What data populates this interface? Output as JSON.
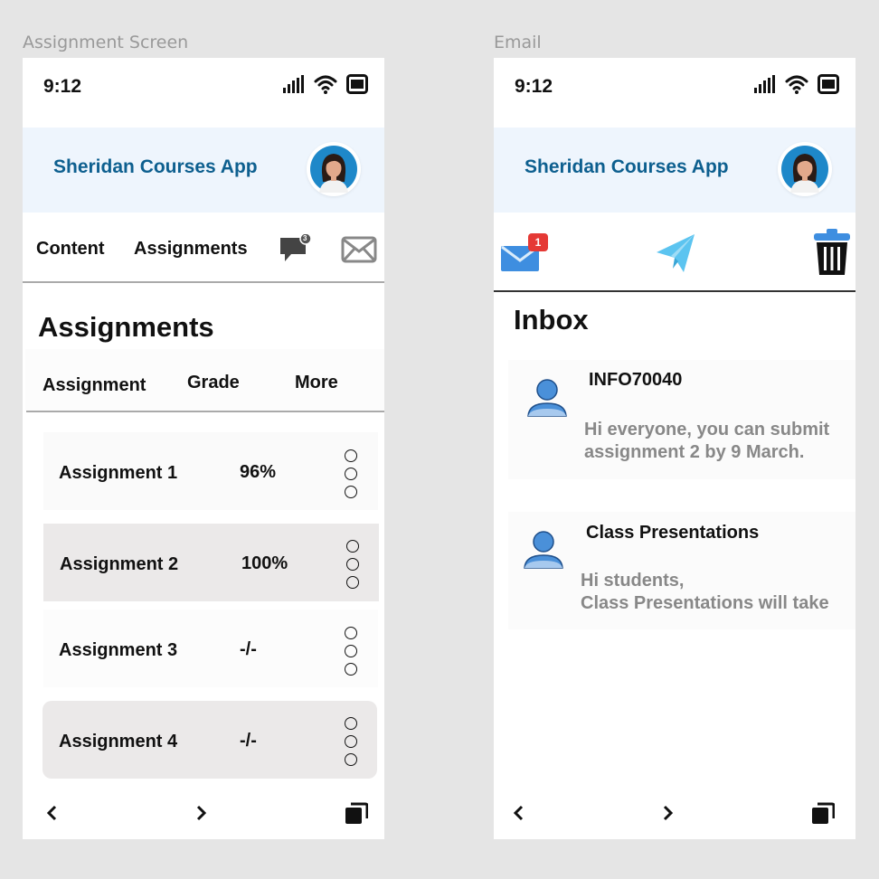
{
  "frames": {
    "assignment_label": "Assignment Screen",
    "email_label": "Email"
  },
  "status": {
    "time": "9:12"
  },
  "app": {
    "title": "Sheridan Courses App"
  },
  "assignment_screen": {
    "tabs": {
      "content": "Content",
      "assignments": "Assignments"
    },
    "chat_badge": "3",
    "section_title": "Assignments",
    "columns": {
      "assignment": "Assignment",
      "grade": "Grade",
      "more": "More"
    },
    "rows": [
      {
        "name": "Assignment 1",
        "grade": "96%"
      },
      {
        "name": "Assignment 2",
        "grade": "100%"
      },
      {
        "name": "Assignment 3",
        "grade": "-/-"
      },
      {
        "name": "Assignment 4",
        "grade": "-/-"
      }
    ]
  },
  "email_screen": {
    "inbox_badge": "1",
    "title": "Inbox",
    "messages": [
      {
        "subject": "INFO70040",
        "body": "Hi everyone, you can submit\nassignment 2 by 9 March."
      },
      {
        "subject": "Class Presentations",
        "body": "Hi students,\nClass Presentations will take"
      }
    ]
  },
  "icons": {
    "signal": "signal-icon",
    "wifi": "wifi-icon",
    "battery": "battery-icon",
    "chat": "chat-icon",
    "mail": "mail-icon",
    "inbox": "inbox-icon",
    "send": "send-icon",
    "trash": "trash-icon",
    "user": "user-icon",
    "back": "chevron-left-icon",
    "forward": "chevron-right-icon",
    "windows": "windows-icon"
  },
  "colors": {
    "header_bg": "#eef5fd",
    "title": "#0d5f8f",
    "badge": "#e53935",
    "row_highlight": "#ebe9e9",
    "body_text": "#888888",
    "send": "#5cc4f0",
    "mail": "#3e8ee0"
  }
}
